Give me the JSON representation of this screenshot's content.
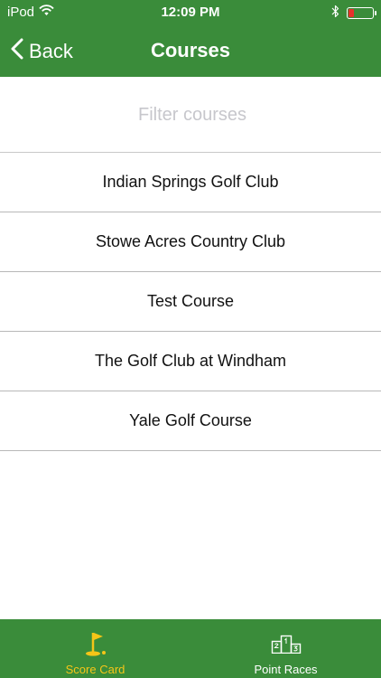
{
  "status_bar": {
    "carrier": "iPod",
    "time": "12:09 PM",
    "battery_color": "#e5312b"
  },
  "nav": {
    "back_label": "Back",
    "title": "Courses"
  },
  "filter": {
    "placeholder": "Filter courses",
    "value": ""
  },
  "courses": [
    "Indian Springs Golf Club",
    "Stowe Acres Country Club",
    "Test Course",
    "The Golf Club at Windham",
    "Yale Golf Course"
  ],
  "tabs": [
    {
      "label": "Score Card",
      "icon": "golf-flag-icon",
      "active": true
    },
    {
      "label": "Point Races",
      "icon": "podium-icon",
      "active": false
    }
  ],
  "colors": {
    "bar_green": "#3a8c3a",
    "active_tab": "#f5c518",
    "inactive_tab": "#ffffff"
  }
}
